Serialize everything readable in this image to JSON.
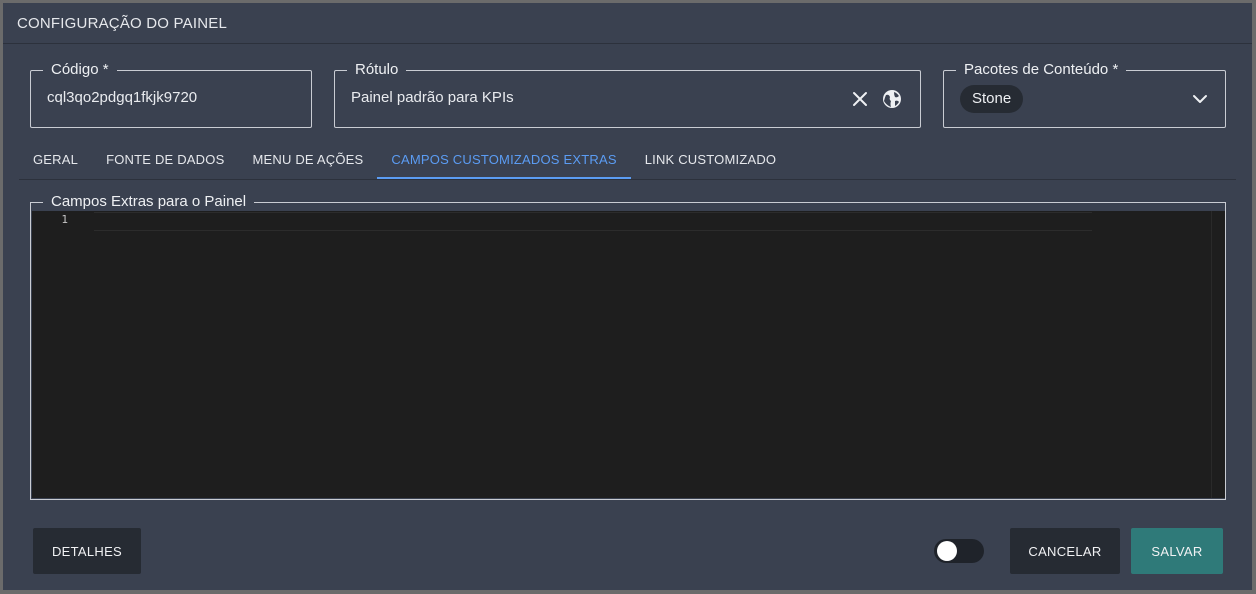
{
  "dialog": {
    "title": "CONFIGURAÇÃO DO PAINEL"
  },
  "fields": {
    "codigo": {
      "label": "Código *",
      "value": "cql3qo2pdgq1fkjk9720"
    },
    "rotulo": {
      "label": "Rótulo",
      "value": "Painel padrão para KPIs"
    },
    "pacotes": {
      "label": "Pacotes de Conteúdo *",
      "chip": "Stone"
    }
  },
  "tabs": [
    {
      "label": "GERAL",
      "active": false
    },
    {
      "label": "FONTE DE DADOS",
      "active": false
    },
    {
      "label": "MENU DE AÇÕES",
      "active": false
    },
    {
      "label": "CAMPOS CUSTOMIZADOS EXTRAS",
      "active": true
    },
    {
      "label": "LINK CUSTOMIZADO",
      "active": false
    }
  ],
  "editor": {
    "label": "Campos Extras para o Painel",
    "line_number": "1"
  },
  "footer": {
    "details_label": "DETALHES",
    "toggle_on": false,
    "cancel_label": "CANCELAR",
    "save_label": "SALVAR"
  },
  "colors": {
    "background": "#3a4150",
    "accent": "#5b9cf3",
    "save_button": "#2f7a79",
    "dark_button": "#262b33"
  },
  "icons": {
    "clear": "close-icon",
    "language": "globe-icon",
    "dropdown": "chevron-down-icon"
  }
}
